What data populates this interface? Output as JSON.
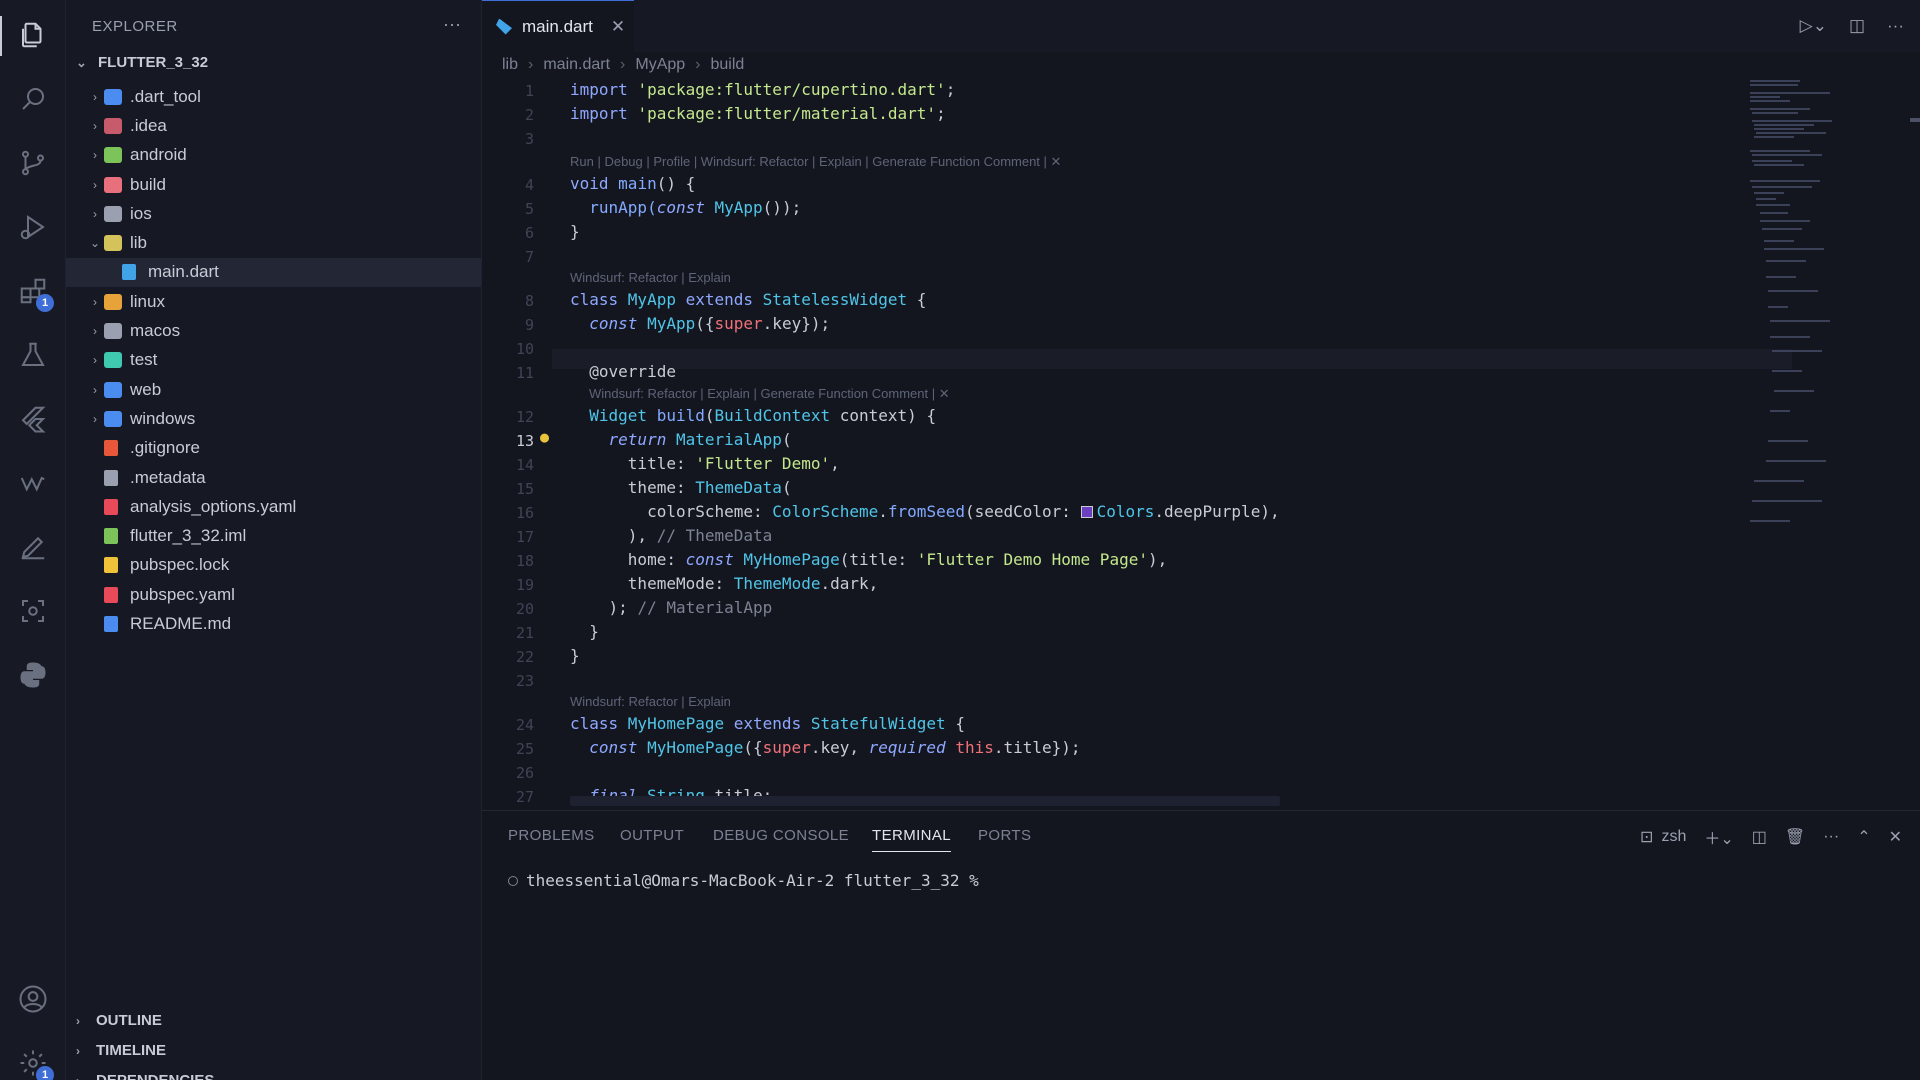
{
  "sidebar": {
    "title": "EXPLORER",
    "more": "···",
    "project": "FLUTTER_3_32",
    "items": [
      {
        "label": ".dart_tool",
        "color": "#4a8cf0",
        "folder": true,
        "depth": 1
      },
      {
        "label": ".idea",
        "color": "#c75b6b",
        "folder": true,
        "depth": 1
      },
      {
        "label": "android",
        "color": "#7cc35a",
        "folder": true,
        "depth": 1
      },
      {
        "label": "build",
        "color": "#e8707c",
        "folder": true,
        "depth": 1
      },
      {
        "label": "ios",
        "color": "#9aa0b0",
        "folder": true,
        "depth": 1
      },
      {
        "label": "lib",
        "color": "#d4c25a",
        "folder": true,
        "depth": 1,
        "open": true
      },
      {
        "label": "main.dart",
        "color": "#41a4e8",
        "folder": false,
        "depth": 2,
        "selected": true
      },
      {
        "label": "linux",
        "color": "#e8a23a",
        "folder": true,
        "depth": 1
      },
      {
        "label": "macos",
        "color": "#9aa0b0",
        "folder": true,
        "depth": 1
      },
      {
        "label": "test",
        "color": "#3ec9b0",
        "folder": true,
        "depth": 1
      },
      {
        "label": "web",
        "color": "#4a8cf0",
        "folder": true,
        "depth": 1
      },
      {
        "label": "windows",
        "color": "#4a8cf0",
        "folder": true,
        "depth": 1
      },
      {
        "label": ".gitignore",
        "color": "#e8573a",
        "folder": false,
        "depth": 1
      },
      {
        "label": ".metadata",
        "color": "#9aa0b0",
        "folder": false,
        "depth": 1
      },
      {
        "label": "analysis_options.yaml",
        "color": "#e84a5a",
        "folder": false,
        "depth": 1
      },
      {
        "label": "flutter_3_32.iml",
        "color": "#7cc35a",
        "folder": false,
        "depth": 1
      },
      {
        "label": "pubspec.lock",
        "color": "#f0c23a",
        "folder": false,
        "depth": 1
      },
      {
        "label": "pubspec.yaml",
        "color": "#e84a5a",
        "folder": false,
        "depth": 1
      },
      {
        "label": "README.md",
        "color": "#4a8cf0",
        "folder": false,
        "depth": 1
      }
    ],
    "sections": [
      "OUTLINE",
      "TIMELINE",
      "DEPENDENCIES"
    ]
  },
  "activity": {
    "icons": [
      "explorer-icon",
      "search-icon",
      "source-control-icon",
      "run-debug-icon",
      "extensions-icon",
      "testing-icon",
      "flutter-icon",
      "windsurf-icon",
      "edit-icon",
      "scan-icon",
      "python-icon",
      "account-icon",
      "settings-icon"
    ],
    "extensions_badge": "1",
    "settings_badge": "1"
  },
  "editor": {
    "tab": {
      "label": "main.dart",
      "close": "✕"
    },
    "breadcrumb": [
      "lib",
      "main.dart",
      "MyApp",
      "build"
    ],
    "lens": {
      "main": "Run | Debug | Profile | Windsurf: Refactor | Explain | Generate Function Comment | ✕",
      "myapp": "Windsurf: Refactor | Explain",
      "build": "Windsurf: Refactor | Explain | Generate Function Comment | ✕",
      "homepage": "Windsurf: Refactor | Explain"
    },
    "line_numbers": [
      "1",
      "2",
      "3",
      "4",
      "5",
      "6",
      "7",
      "8",
      "9",
      "10",
      "11",
      "12",
      "13",
      "14",
      "15",
      "16",
      "17",
      "18",
      "19",
      "20",
      "21",
      "22",
      "23",
      "24",
      "25",
      "26",
      "27"
    ],
    "code": {
      "l1a": "import ",
      "l1b": "'package:flutter/cupertino.dart'",
      "l1c": ";",
      "l2a": "import ",
      "l2b": "'package:flutter/material.dart'",
      "l2c": ";",
      "l4a": "void ",
      "l4b": "main",
      "l4c": "() {",
      "l5a": "  runApp(",
      "l5b": "const ",
      "l5c": "MyApp",
      "l5d": "());",
      "l6": "}",
      "l8a": "class ",
      "l8b": "MyApp ",
      "l8c": "extends ",
      "l8d": "StatelessWidget",
      "l8e": " {",
      "l9a": "  const ",
      "l9b": "MyApp",
      "l9c": "({",
      "l9d": "super",
      "l9e": ".key});",
      "l11": "  @override",
      "l12a": "  Widget ",
      "l12b": "build",
      "l12c": "(",
      "l12d": "BuildContext",
      "l12e": " context) {",
      "l13a": "    return ",
      "l13b": "MaterialApp",
      "l13c": "(",
      "l14a": "      title: ",
      "l14b": "'Flutter Demo'",
      "l14c": ",",
      "l15a": "      theme: ",
      "l15b": "ThemeData",
      "l15c": "(",
      "l16a": "        colorScheme: ",
      "l16b": "ColorScheme",
      "l16c": ".",
      "l16d": "fromSeed",
      "l16e": "(seedColor: ",
      "l16f": "Colors",
      "l16g": ".deepPurple),",
      "l17a": "      ), ",
      "l17b": "// ThemeData",
      "l18a": "      home: ",
      "l18b": "const ",
      "l18c": "MyHomePage",
      "l18d": "(title: ",
      "l18e": "'Flutter Demo Home Page'",
      "l18f": "),",
      "l19a": "      themeMode: ",
      "l19b": "ThemeMode",
      "l19c": ".dark,",
      "l20a": "    ); ",
      "l20b": "// MaterialApp",
      "l21": "  }",
      "l22": "}",
      "l24a": "class ",
      "l24b": "MyHomePage ",
      "l24c": "extends ",
      "l24d": "StatefulWidget",
      "l24e": " {",
      "l25a": "  const ",
      "l25b": "MyHomePage",
      "l25c": "({",
      "l25d": "super",
      "l25e": ".key, ",
      "l25f": "required ",
      "l25g": "this",
      "l25h": ".title});",
      "l27a": "  final ",
      "l27b": "String",
      "l27c": " title;"
    },
    "swatch_color": "#6a3fc0"
  },
  "panel": {
    "tabs": [
      "PROBLEMS",
      "OUTPUT",
      "DEBUG CONSOLE",
      "TERMINAL",
      "PORTS"
    ],
    "active_tab": "TERMINAL",
    "shell": "zsh",
    "prompt": "theessential@Omars-MacBook-Air-2 flutter_3_32 %"
  }
}
